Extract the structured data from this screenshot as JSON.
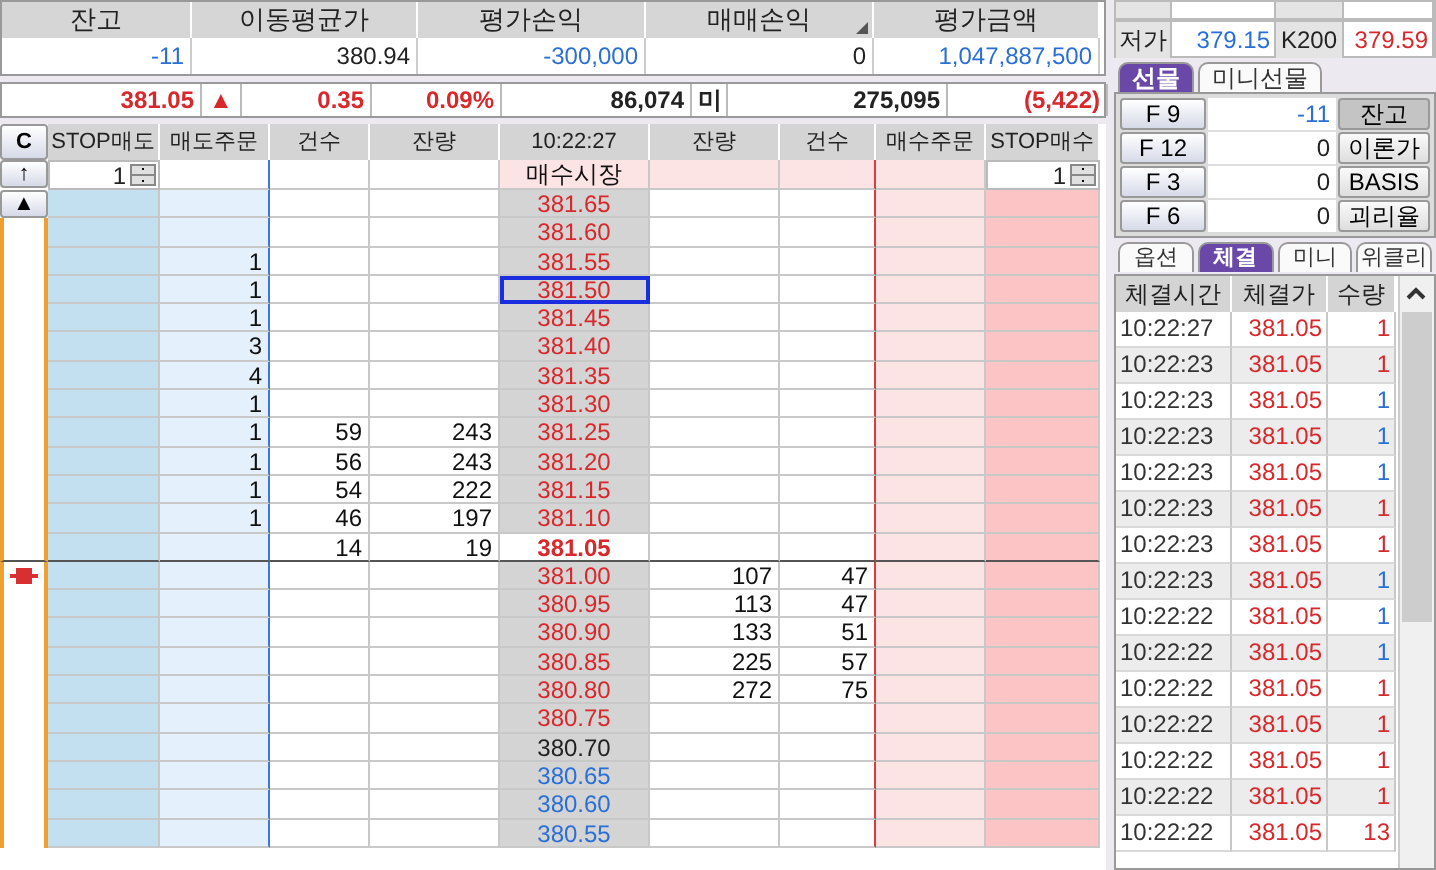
{
  "summary": {
    "columns": [
      {
        "label": "잔고",
        "value": "-11",
        "color": "#2a6fd8"
      },
      {
        "label": "이동평균가",
        "value": "380.94",
        "color": "#222222"
      },
      {
        "label": "평가손익",
        "value": "-300,000",
        "color": "#2a6fd8"
      },
      {
        "label": "매매손익",
        "value": "0",
        "color": "#222222",
        "sort_mark": true
      },
      {
        "label": "평가금액",
        "value": "1,047,887,500",
        "color": "#2a6fd8"
      }
    ]
  },
  "quote": {
    "price": "381.05",
    "arrow": "▲",
    "change": "0.35",
    "rate": "0.09%",
    "volume": "86,074",
    "unit": "미",
    "open_interest": "275,095",
    "oi_change": "(5,422)"
  },
  "order_book": {
    "clear_button": "C",
    "up_button": "↑",
    "top_button": "▲",
    "columns": [
      "STOP매도",
      "매도주문",
      "건수",
      "잔량",
      "10:22:27",
      "잔량",
      "건수",
      "매수주문",
      "STOP매수"
    ],
    "sell_stop_qty": "1",
    "market_label": "매수시장",
    "buy_stop_qty": "1",
    "rows": [
      {
        "price": "381.65",
        "color": "#d8282c",
        "selected": false
      },
      {
        "price": "381.60",
        "color": "#d8282c",
        "selected": false
      },
      {
        "price": "381.55",
        "color": "#d8282c",
        "selected": false,
        "sell_orders": "1"
      },
      {
        "price": "381.50",
        "color": "#d8282c",
        "selected": true,
        "sell_orders": "1"
      },
      {
        "price": "381.45",
        "color": "#d8282c",
        "selected": false,
        "sell_orders": "1"
      },
      {
        "price": "381.40",
        "color": "#d8282c",
        "selected": false,
        "sell_orders": "3"
      },
      {
        "price": "381.35",
        "color": "#d8282c",
        "selected": false,
        "sell_orders": "4"
      },
      {
        "price": "381.30",
        "color": "#d8282c",
        "selected": false,
        "sell_orders": "1"
      },
      {
        "price": "381.25",
        "color": "#d8282c",
        "selected": false,
        "sell_orders": "1",
        "sell_count": "59",
        "sell_volume": "243"
      },
      {
        "price": "381.20",
        "color": "#d8282c",
        "selected": false,
        "sell_orders": "1",
        "sell_count": "56",
        "sell_volume": "243"
      },
      {
        "price": "381.15",
        "color": "#d8282c",
        "selected": false,
        "sell_orders": "1",
        "sell_count": "54",
        "sell_volume": "222"
      },
      {
        "price": "381.10",
        "color": "#d8282c",
        "selected": false,
        "sell_orders": "1",
        "sell_count": "46",
        "sell_volume": "197"
      },
      {
        "price": "381.05",
        "color": "#d8282c",
        "selected": false,
        "current": true,
        "sell_count": "14",
        "sell_volume": "19"
      },
      {
        "price": "381.00",
        "color": "#d8282c",
        "selected": false,
        "marked": true,
        "buy_volume": "107",
        "buy_count": "47"
      },
      {
        "price": "380.95",
        "color": "#d8282c",
        "selected": false,
        "buy_volume": "113",
        "buy_count": "47"
      },
      {
        "price": "380.90",
        "color": "#d8282c",
        "selected": false,
        "buy_volume": "133",
        "buy_count": "51"
      },
      {
        "price": "380.85",
        "color": "#d8282c",
        "selected": false,
        "buy_volume": "225",
        "buy_count": "57"
      },
      {
        "price": "380.80",
        "color": "#d8282c",
        "selected": false,
        "buy_volume": "272",
        "buy_count": "75"
      },
      {
        "price": "380.75",
        "color": "#d8282c",
        "selected": false
      },
      {
        "price": "380.70",
        "color": "#222222",
        "selected": false
      },
      {
        "price": "380.65",
        "color": "#2a6fd8",
        "selected": false
      },
      {
        "price": "380.60",
        "color": "#2a6fd8",
        "selected": false
      },
      {
        "price": "380.55",
        "color": "#2a6fd8",
        "selected": false
      }
    ]
  },
  "side_panel": {
    "low": {
      "label": "저가",
      "value": "379.15"
    },
    "k200": {
      "label": "K200",
      "value": "379.59"
    },
    "futures_tabs": [
      {
        "label": "선물",
        "selected": true
      },
      {
        "label": "미니선물",
        "selected": false
      }
    ],
    "futures": [
      {
        "code": "F 9",
        "value": "-11",
        "color": "#2a6fd8",
        "action": "잔고",
        "selected": true
      },
      {
        "code": "F 12",
        "value": "0",
        "color": "#222222",
        "action": "이론가",
        "selected": false
      },
      {
        "code": "F 3",
        "value": "0",
        "color": "#222222",
        "action": "BASIS",
        "selected": false
      },
      {
        "code": "F 6",
        "value": "0",
        "color": "#222222",
        "action": "괴리율",
        "selected": false
      }
    ],
    "trade_tabs": [
      {
        "label": "옵션",
        "selected": false
      },
      {
        "label": "체결",
        "selected": true
      },
      {
        "label": "미니",
        "selected": false
      },
      {
        "label": "위클리",
        "selected": false
      }
    ],
    "trades": {
      "columns": [
        "체결시간",
        "체결가",
        "수량"
      ],
      "rows": [
        {
          "time": "10:22:27",
          "price": "381.05",
          "qty": "1",
          "color": "#d8282c"
        },
        {
          "time": "10:22:23",
          "price": "381.05",
          "qty": "1",
          "color": "#d8282c"
        },
        {
          "time": "10:22:23",
          "price": "381.05",
          "qty": "1",
          "color": "#2a6fd8"
        },
        {
          "time": "10:22:23",
          "price": "381.05",
          "qty": "1",
          "color": "#2a6fd8"
        },
        {
          "time": "10:22:23",
          "price": "381.05",
          "qty": "1",
          "color": "#2a6fd8"
        },
        {
          "time": "10:22:23",
          "price": "381.05",
          "qty": "1",
          "color": "#d8282c"
        },
        {
          "time": "10:22:23",
          "price": "381.05",
          "qty": "1",
          "color": "#d8282c"
        },
        {
          "time": "10:22:23",
          "price": "381.05",
          "qty": "1",
          "color": "#2a6fd8"
        },
        {
          "time": "10:22:22",
          "price": "381.05",
          "qty": "1",
          "color": "#2a6fd8"
        },
        {
          "time": "10:22:22",
          "price": "381.05",
          "qty": "1",
          "color": "#2a6fd8"
        },
        {
          "time": "10:22:22",
          "price": "381.05",
          "qty": "1",
          "color": "#d8282c"
        },
        {
          "time": "10:22:22",
          "price": "381.05",
          "qty": "1",
          "color": "#d8282c"
        },
        {
          "time": "10:22:22",
          "price": "381.05",
          "qty": "1",
          "color": "#d8282c"
        },
        {
          "time": "10:22:22",
          "price": "381.05",
          "qty": "1",
          "color": "#d8282c"
        },
        {
          "time": "10:22:22",
          "price": "381.05",
          "qty": "13",
          "color": "#d8282c"
        }
      ]
    }
  }
}
